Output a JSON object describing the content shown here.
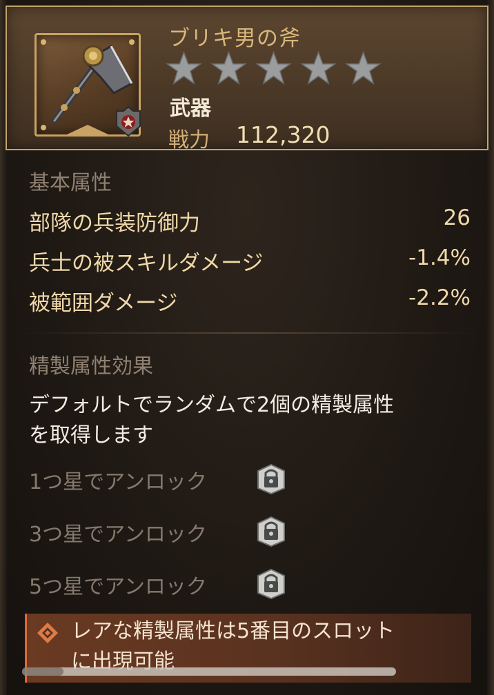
{
  "item": {
    "name": "ブリキ男の斧",
    "star_rating": 0,
    "star_max": 5,
    "type": "武器",
    "power_label": "戦力",
    "power_value": "112,320"
  },
  "basic_attributes": {
    "title": "基本属性",
    "rows": [
      {
        "name": "部隊の兵装防御力",
        "value": "26"
      },
      {
        "name": "兵士の被スキルダメージ",
        "value": "-1.4%"
      },
      {
        "name": "被範囲ダメージ",
        "value": "-2.2%"
      }
    ]
  },
  "refine": {
    "title": "精製属性効果",
    "description_line1": "デフォルトでランダムで2個の精製属性",
    "description_line2": "を取得します",
    "unlocks": [
      {
        "label": "1つ星でアンロック",
        "icon": "lock-icon"
      },
      {
        "label": "3つ星でアンロック",
        "icon": "lock-icon"
      },
      {
        "label": "5つ星でアンロック",
        "icon": "lock-icon"
      }
    ]
  },
  "notice": {
    "line1": "レアな精製属性は5番目のスロット",
    "line2": "に出現可能",
    "icon": "diamond-icon"
  },
  "colors": {
    "gold": "#d9b77a",
    "accent_text": "#f0d8a8",
    "muted": "#8f8172",
    "notice_bg": "#5a3220"
  }
}
